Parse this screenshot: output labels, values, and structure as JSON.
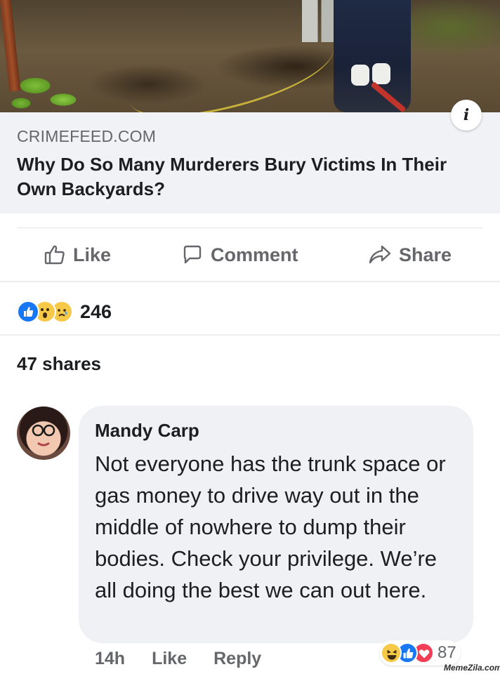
{
  "post": {
    "link_domain": "CRIMEFEED.COM",
    "link_title": "Why Do So Many Murderers Bury Victims In Their Own Backyards?",
    "info_icon": "info-icon"
  },
  "actions": {
    "like_label": "Like",
    "comment_label": "Comment",
    "share_label": "Share"
  },
  "reactions": {
    "types": [
      "like",
      "wow",
      "sad"
    ],
    "count": "246"
  },
  "shares_text": "47 shares",
  "comment": {
    "author": "Mandy Carp",
    "text": "Not everyone has the trunk space or gas money to drive way out in the middle of nowhere to dump their bodies. Check your privilege. We’re all doing the best we can out here.",
    "time": "14h",
    "like_label": "Like",
    "reply_label": "Reply",
    "reaction_types": [
      "haha",
      "like",
      "love"
    ],
    "reaction_count": "87"
  },
  "watermark": "MemeZila.com",
  "colors": {
    "facebook_blue": "#1877f2",
    "secondary_text": "#65676b",
    "caption_background": "#f0f2f5",
    "bubble_background": "#eff1f4"
  }
}
